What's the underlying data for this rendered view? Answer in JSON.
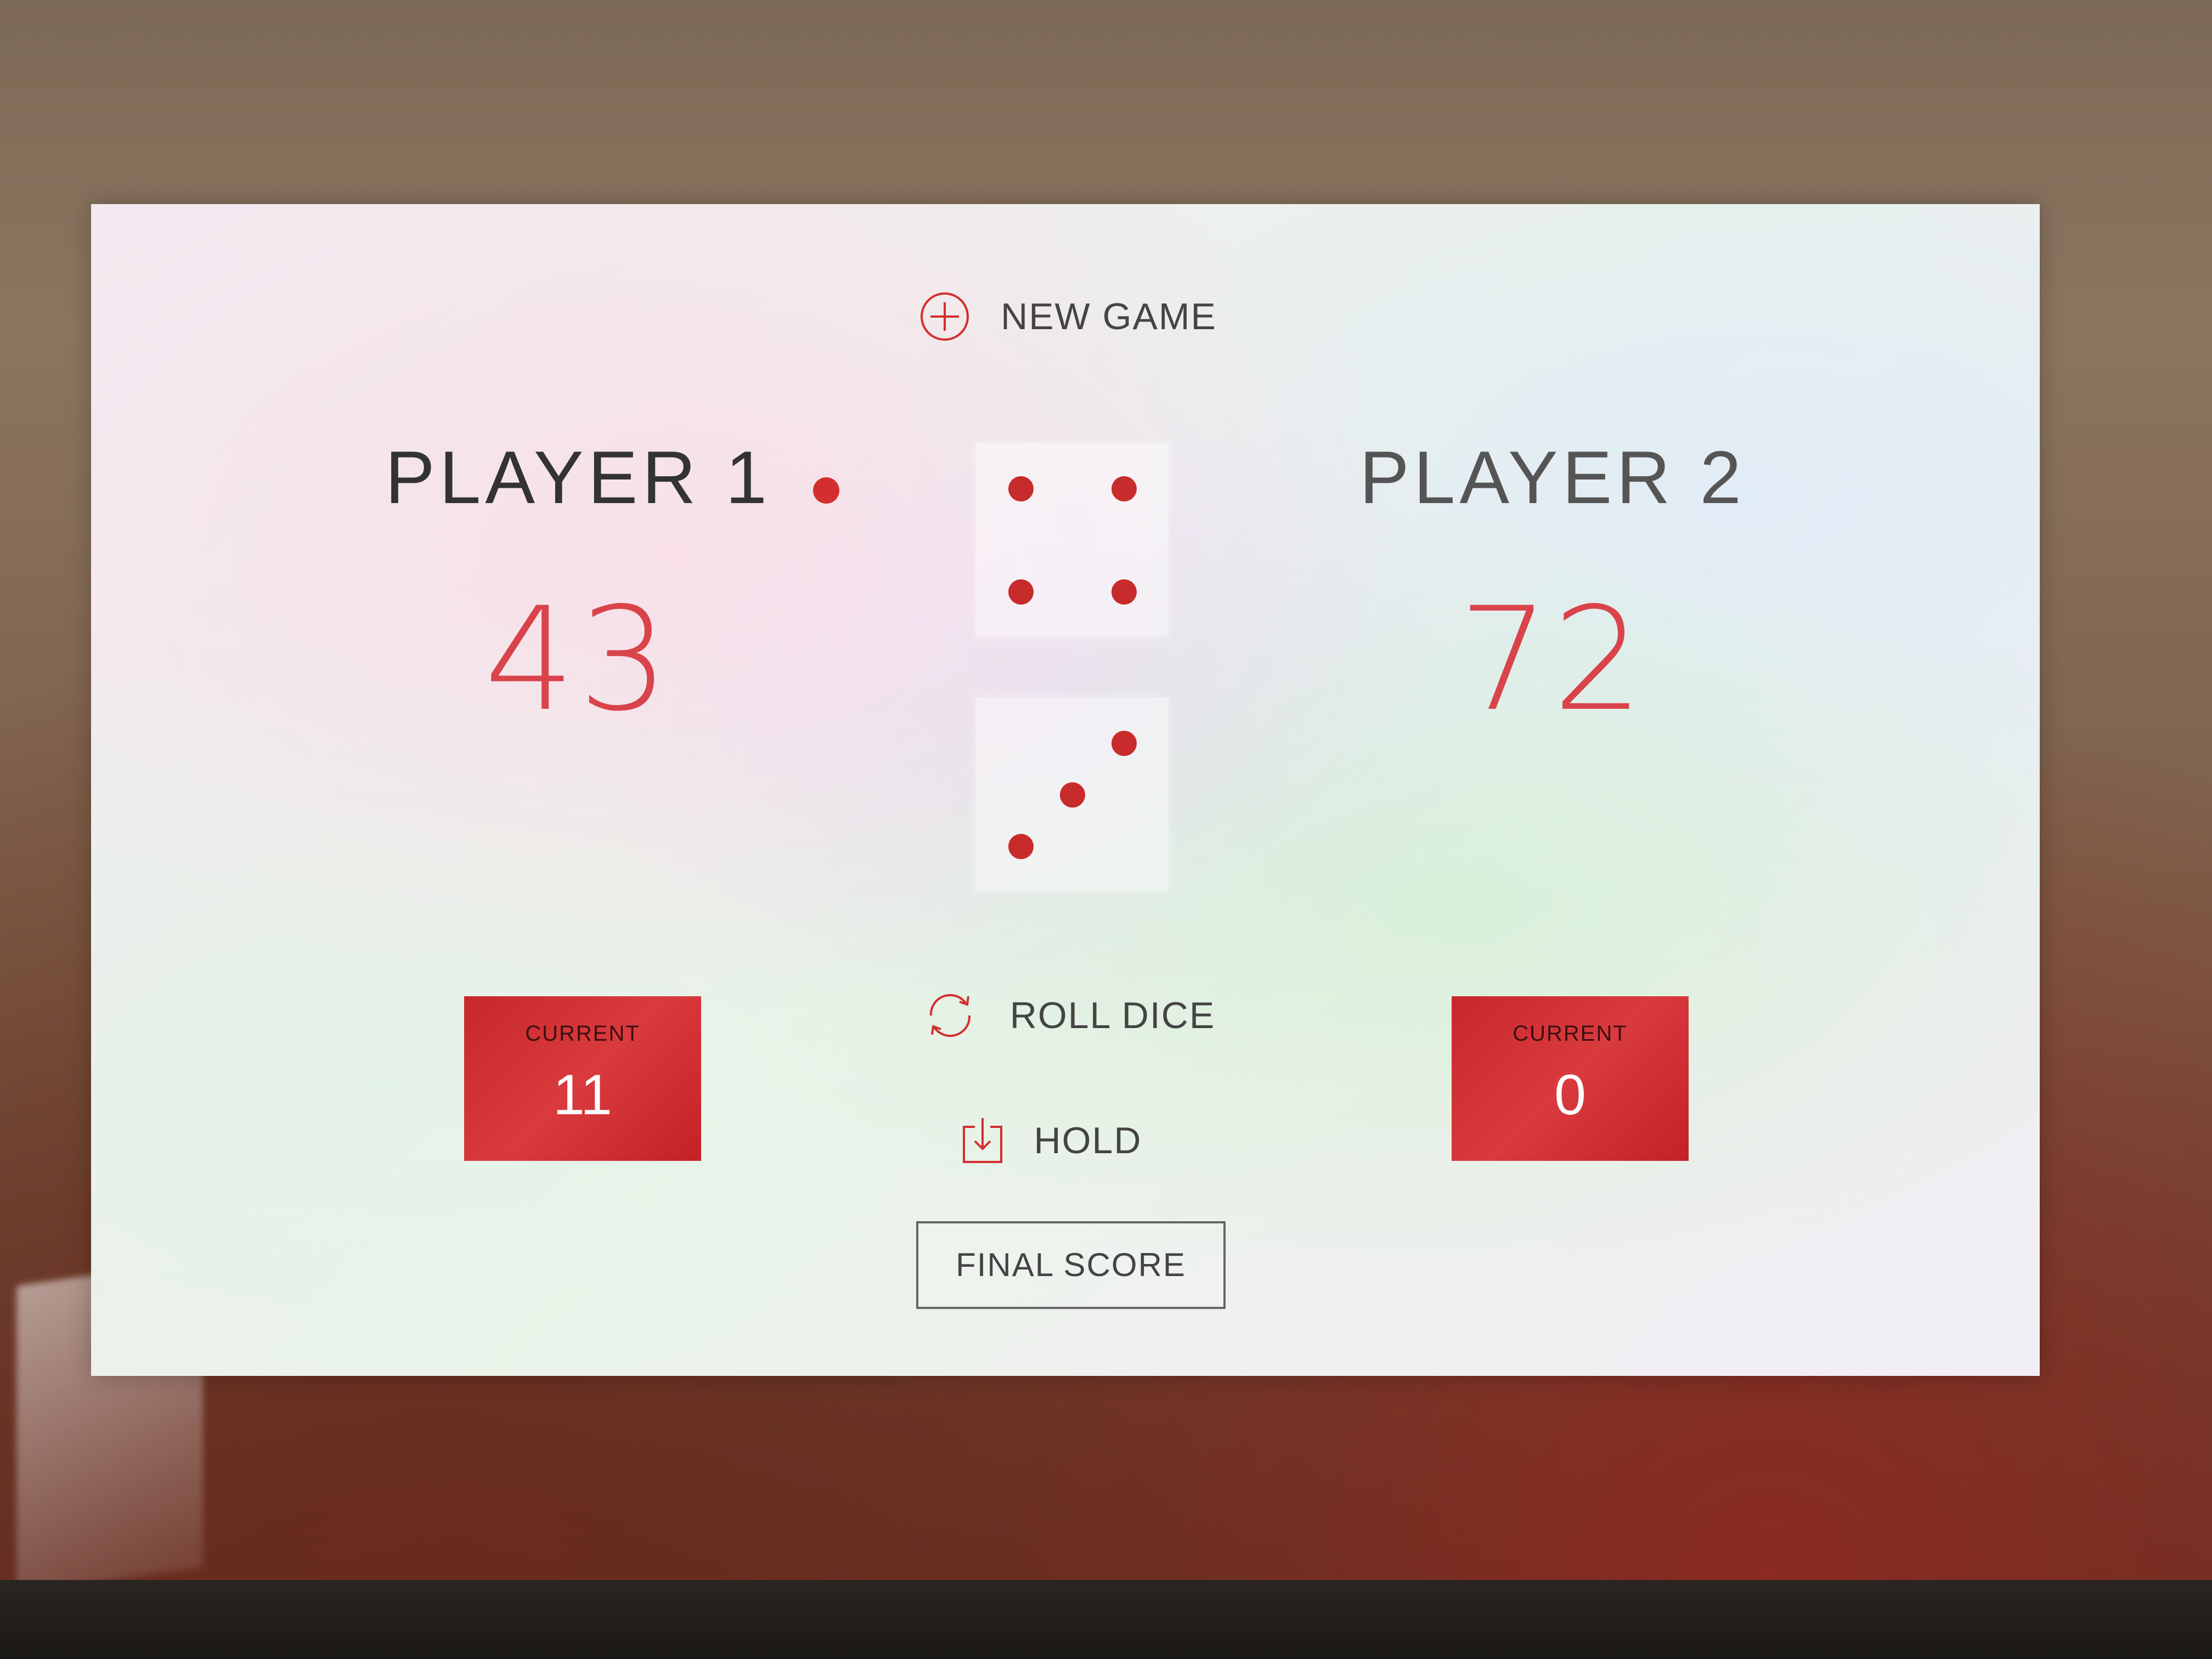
{
  "toolbar": {
    "new_game_label": "NEW GAME",
    "roll_dice_label": "ROLL DICE",
    "hold_label": "HOLD",
    "final_score_label": "FINAL SCORE"
  },
  "players": [
    {
      "name": "PLAYER 1",
      "score": "43",
      "current_label": "CURRENT",
      "current_score": "11",
      "active": true
    },
    {
      "name": "PLAYER 2",
      "score": "72",
      "current_label": "CURRENT",
      "current_score": "0",
      "active": false
    }
  ],
  "dice": [
    {
      "value": 4
    },
    {
      "value": 3
    }
  ],
  "colors": {
    "accent": "#d32f2f",
    "score_text": "#d9434a",
    "current_box": "#c8282c"
  },
  "icons": {
    "new_game": "plus-circle-icon",
    "roll_dice": "refresh-icon",
    "hold": "download-icon",
    "active_player": "active-dot-icon"
  }
}
